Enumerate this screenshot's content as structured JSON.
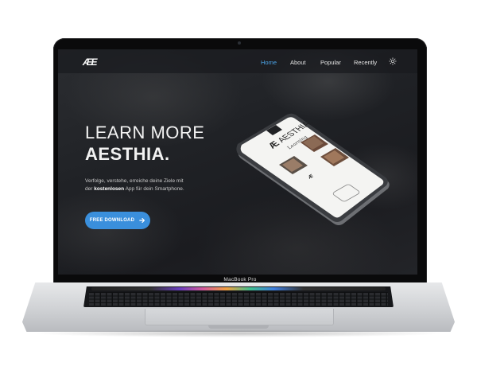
{
  "navbar": {
    "logo": "ÆE",
    "items": [
      {
        "label": "Home",
        "active": true
      },
      {
        "label": "About",
        "active": false
      },
      {
        "label": "Popular",
        "active": false
      },
      {
        "label": "Recently",
        "active": false
      }
    ],
    "theme_icon": "sun-icon"
  },
  "hero": {
    "title_line1": "LEARN MORE",
    "title_line2": "AESTHIA.",
    "desc_part1": "Verfolge, verstehe, erreiche deine Ziele mit der ",
    "desc_bold": "kostenlosen",
    "desc_part2": " App für dein Smartphone.",
    "button_label": "FREE DOWNLOAD",
    "button_icon": "arrow-right-icon"
  },
  "phone": {
    "brand": "AESTHIA",
    "subtitle": "Learning"
  },
  "laptop": {
    "model_label": "MacBook Pro"
  },
  "colors": {
    "accent": "#4ba3e6",
    "button": "#3a8fdc",
    "background": "#202226"
  }
}
